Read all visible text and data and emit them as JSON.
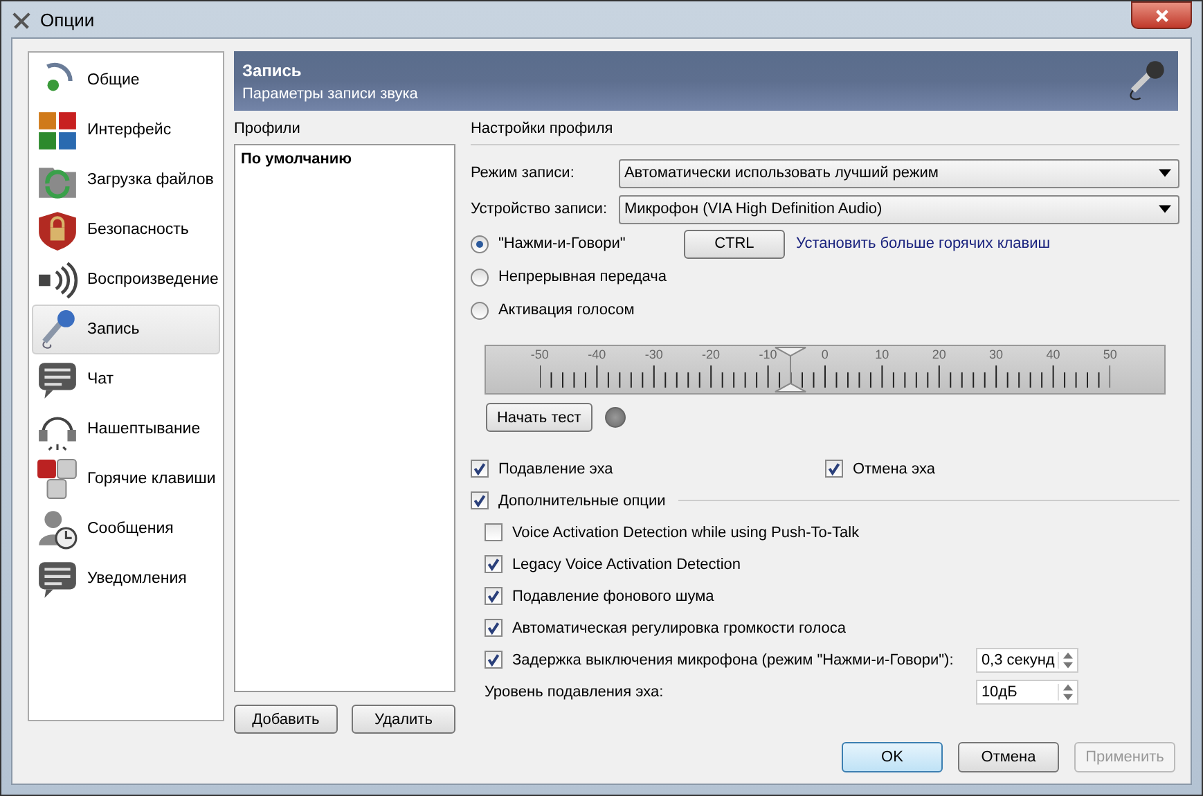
{
  "window": {
    "title": "Опции"
  },
  "sidebar": {
    "items": [
      {
        "label": "Общие",
        "selected": false
      },
      {
        "label": "Интерфейс",
        "selected": false
      },
      {
        "label": "Загрузка файлов",
        "selected": false
      },
      {
        "label": "Безопасность",
        "selected": false
      },
      {
        "label": "Воспроизведение",
        "selected": false
      },
      {
        "label": "Запись",
        "selected": true
      },
      {
        "label": "Чат",
        "selected": false
      },
      {
        "label": "Нашептывание",
        "selected": false
      },
      {
        "label": "Горячие клавиши",
        "selected": false
      },
      {
        "label": "Сообщения",
        "selected": false
      },
      {
        "label": "Уведомления",
        "selected": false
      }
    ]
  },
  "header": {
    "title": "Запись",
    "subtitle": "Параметры записи звука"
  },
  "profiles": {
    "label": "Профили",
    "items": [
      {
        "label": "По умолчанию",
        "selected": false
      }
    ],
    "buttons": [
      "Добавить",
      "Удалить"
    ]
  },
  "settings": {
    "label": "Настройки профиля",
    "fields": [
      {
        "label": "Режим записи:",
        "value": "Автоматически использовать лучший режим"
      },
      {
        "label": "Устройство записи:",
        "value": "Микрофон (VIA High Definition Audio)"
      }
    ],
    "modes": [
      {
        "label": "\"Нажми-и-Говори\"",
        "selected": true
      },
      {
        "label": "Непрерывная передача",
        "selected": false
      },
      {
        "label": "Активация голосом",
        "selected": false
      }
    ],
    "hotkey": "CTRL",
    "hotkey_link": "Установить больше горячих клавиш",
    "meter": {
      "labels": [
        "-50",
        "-40",
        "-30",
        "-20",
        "-10",
        "0",
        "10",
        "20",
        "30",
        "40",
        "50"
      ],
      "level": 0.44
    },
    "test_button": "Начать тест",
    "echo": [
      {
        "label": "Подавление эха",
        "checked": true
      },
      {
        "label": "Отмена эха",
        "checked": true
      }
    ],
    "advanced": {
      "label": "Дополнительные опции",
      "checked": true
    },
    "options": [
      {
        "kind": "checkbox",
        "label": "Voice Activation Detection while using Push-To-Talk",
        "checked": false
      },
      {
        "kind": "checkbox",
        "label": "Legacy Voice Activation Detection",
        "checked": true
      },
      {
        "kind": "checkbox",
        "label": "Подавление фонового шума",
        "checked": true
      },
      {
        "kind": "checkbox",
        "label": "Автоматическая регулировка громкости голоса",
        "checked": true
      },
      {
        "kind": "checkspin",
        "label": "Задержка выключения микрофона (режим \"Нажми-и-Говори\"):",
        "checked": true,
        "value": "0,3 секунд"
      },
      {
        "kind": "spin",
        "label": "Уровень подавления эха:",
        "value": "10дБ"
      }
    ]
  },
  "buttons": [
    {
      "label": "OK",
      "disabled": false,
      "default": true
    },
    {
      "label": "Отмена",
      "disabled": false,
      "default": false
    },
    {
      "label": "Применить",
      "disabled": true,
      "default": false
    }
  ]
}
